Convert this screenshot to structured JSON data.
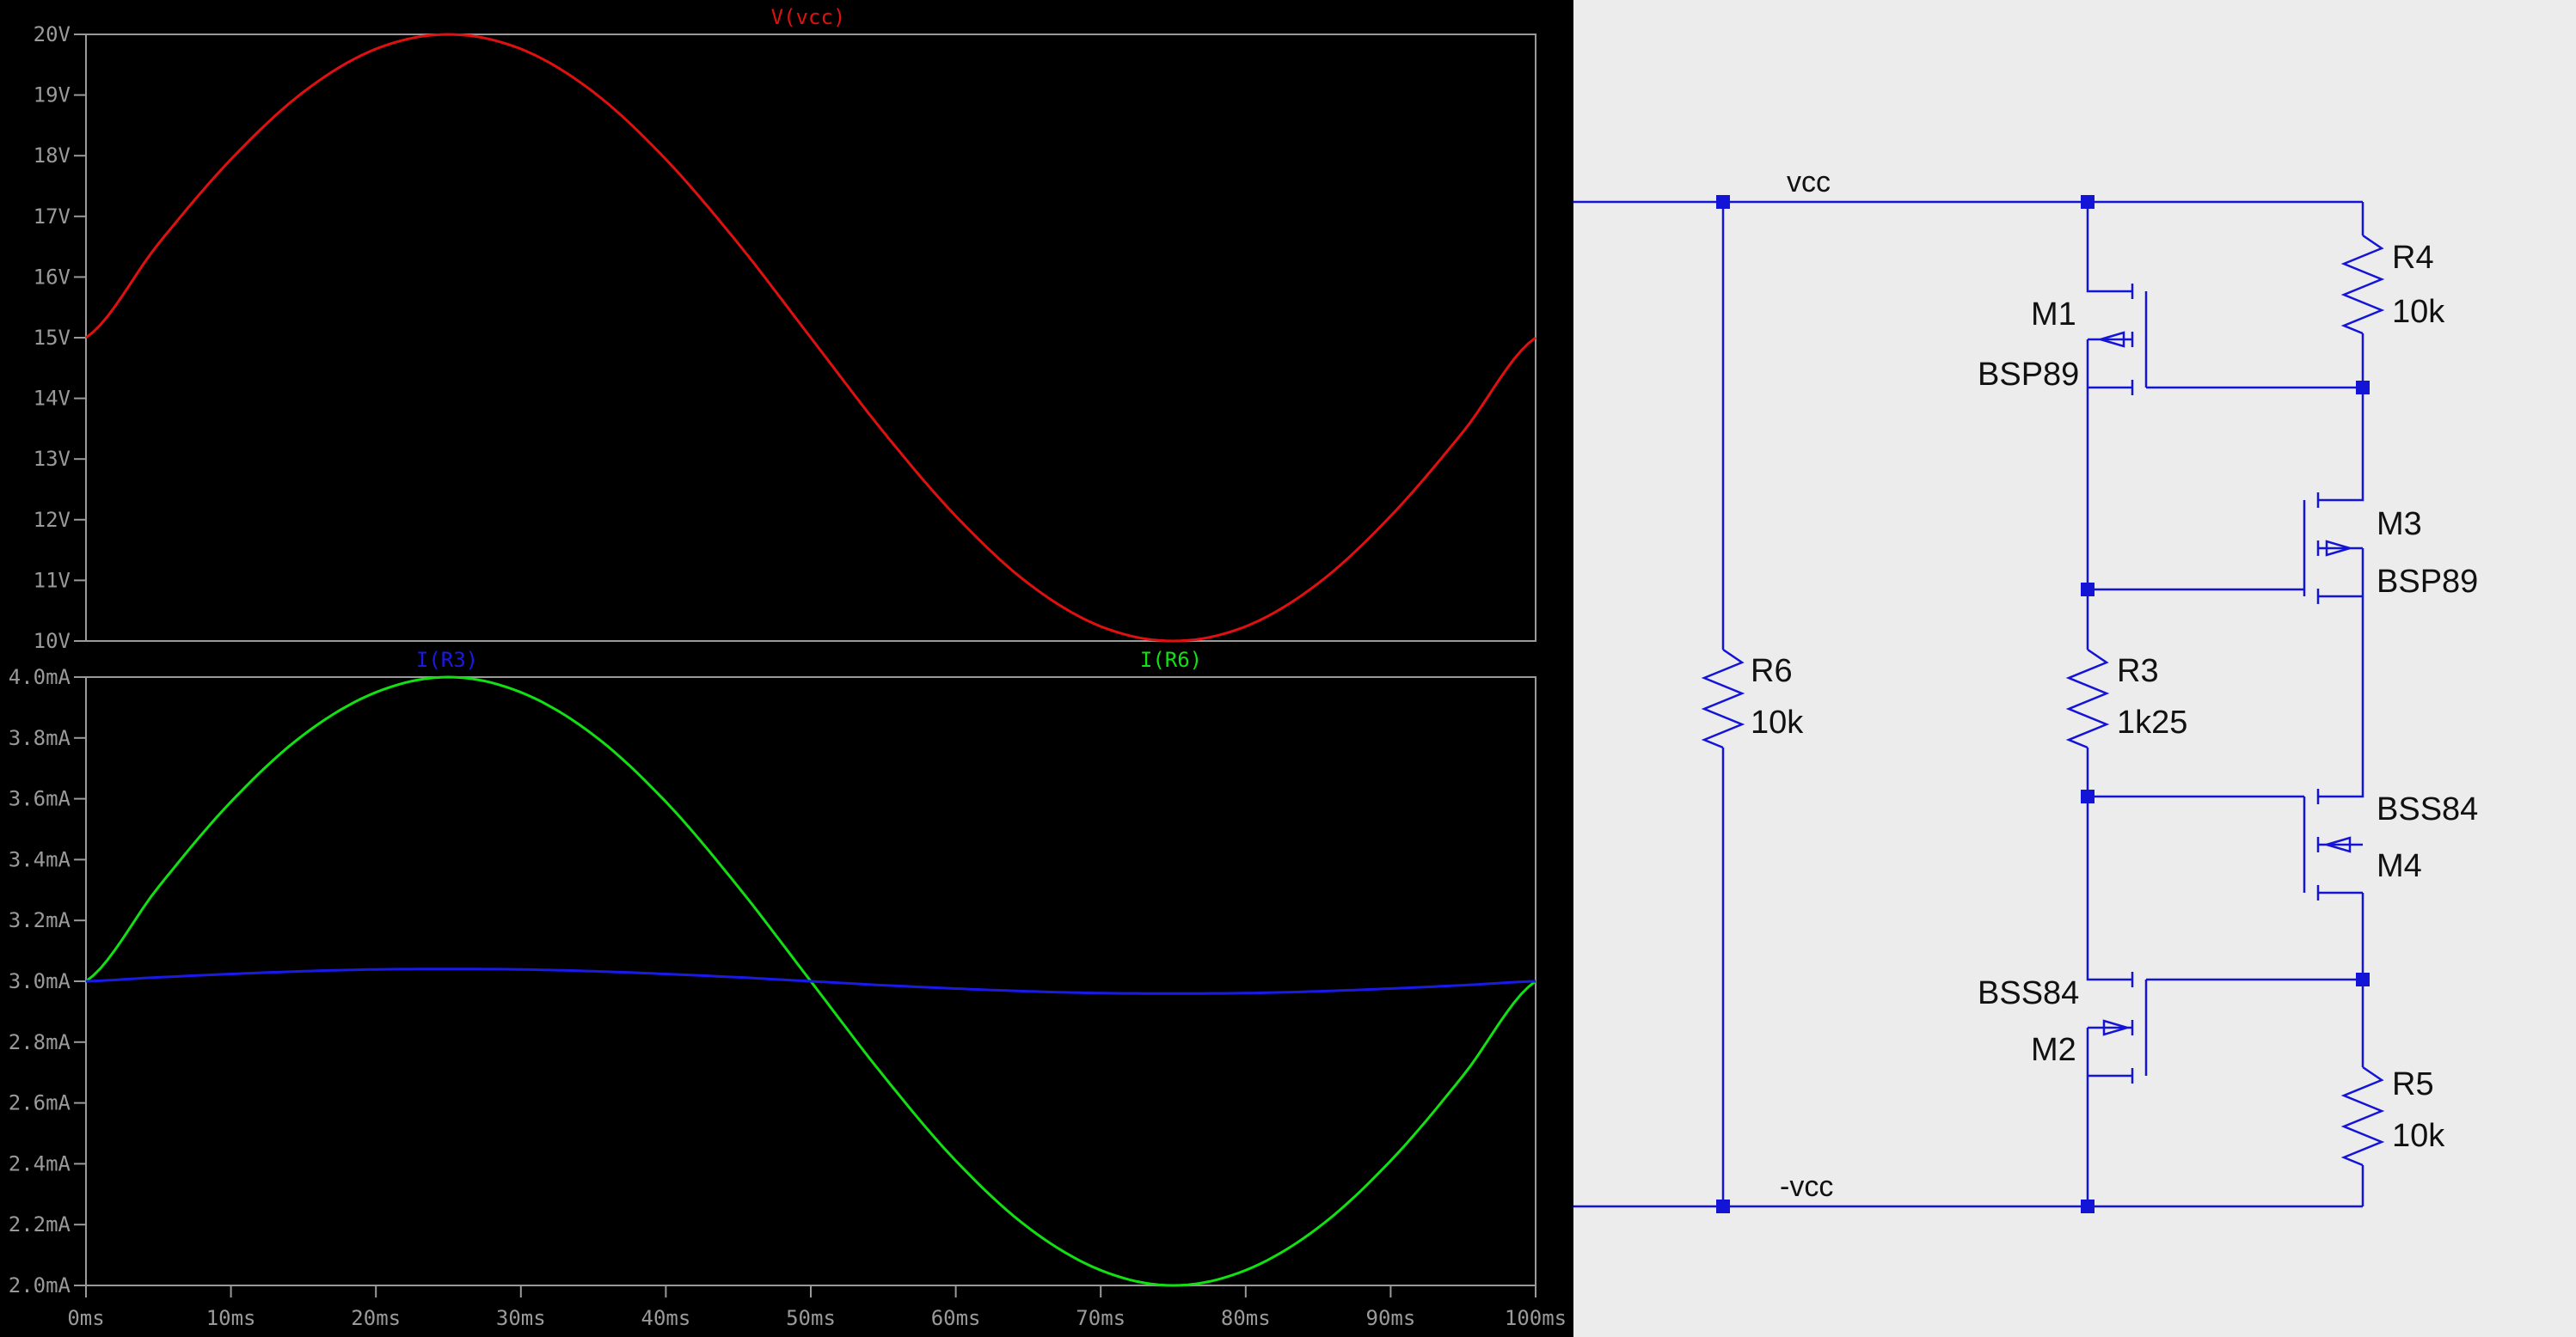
{
  "waveform": {
    "top_plot": {
      "traces": [
        {
          "label": "V(vcc)",
          "color": "#e01010"
        }
      ],
      "y_ticks": [
        "20V",
        "19V",
        "18V",
        "17V",
        "16V",
        "15V",
        "14V",
        "13V",
        "12V",
        "11V",
        "10V"
      ]
    },
    "bottom_plot": {
      "traces": [
        {
          "label": "I(R3)",
          "color": "#1a1ae6"
        },
        {
          "label": "I(R6)",
          "color": "#12e012"
        }
      ],
      "y_ticks": [
        "4.0mA",
        "3.8mA",
        "3.6mA",
        "3.4mA",
        "3.2mA",
        "3.0mA",
        "2.8mA",
        "2.6mA",
        "2.4mA",
        "2.2mA",
        "2.0mA"
      ]
    },
    "x_ticks": [
      "0ms",
      "10ms",
      "20ms",
      "30ms",
      "40ms",
      "50ms",
      "60ms",
      "70ms",
      "80ms",
      "90ms",
      "100ms"
    ]
  },
  "chart_data": [
    {
      "type": "line",
      "title": "",
      "xlabel": "",
      "ylabel": "",
      "x": [
        0,
        5,
        10,
        15,
        20,
        25,
        30,
        35,
        40,
        45,
        50,
        55,
        60,
        65,
        70,
        75,
        80,
        85,
        90,
        95,
        100
      ],
      "xlim": [
        0,
        100
      ],
      "ylim": [
        10,
        20
      ],
      "x_unit": "ms",
      "y_unit": "V",
      "grid": false,
      "series": [
        {
          "name": "V(vcc)",
          "color": "#e01010",
          "values": [
            15,
            16.55,
            17.94,
            19.05,
            19.76,
            20,
            19.76,
            19.05,
            17.94,
            16.55,
            15,
            13.45,
            12.06,
            10.95,
            10.24,
            10,
            10.24,
            10.95,
            12.06,
            13.45,
            15
          ]
        }
      ]
    },
    {
      "type": "line",
      "title": "",
      "xlabel": "",
      "ylabel": "",
      "x": [
        0,
        5,
        10,
        15,
        20,
        25,
        30,
        35,
        40,
        45,
        50,
        55,
        60,
        65,
        70,
        75,
        80,
        85,
        90,
        95,
        100
      ],
      "xlim": [
        0,
        100
      ],
      "ylim": [
        2.0,
        4.0
      ],
      "x_unit": "ms",
      "y_unit": "mA",
      "grid": false,
      "series": [
        {
          "name": "I(R6)",
          "color": "#12e012",
          "values": [
            3.0,
            3.31,
            3.59,
            3.81,
            3.95,
            4.0,
            3.95,
            3.81,
            3.59,
            3.31,
            3.0,
            2.69,
            2.41,
            2.19,
            2.05,
            2.0,
            2.05,
            2.19,
            2.41,
            2.69,
            3.0
          ]
        },
        {
          "name": "I(R3)",
          "color": "#1a1ae6",
          "values": [
            3.0,
            3.013,
            3.024,
            3.033,
            3.039,
            3.04,
            3.039,
            3.033,
            3.024,
            3.013,
            3.0,
            2.987,
            2.976,
            2.967,
            2.961,
            2.96,
            2.961,
            2.967,
            2.976,
            2.987,
            3.0
          ]
        }
      ]
    }
  ],
  "schematic": {
    "nets": {
      "vcc": "vcc",
      "neg_vcc": "-vcc"
    },
    "components": {
      "R4": {
        "ref": "R4",
        "value": "10k"
      },
      "R6": {
        "ref": "R6",
        "value": "10k"
      },
      "R3": {
        "ref": "R3",
        "value": "1k25"
      },
      "R5": {
        "ref": "R5",
        "value": "10k"
      },
      "M1": {
        "ref": "M1",
        "model": "BSP89"
      },
      "M3": {
        "ref": "M3",
        "model": "BSP89"
      },
      "M4": {
        "ref": "M4",
        "model": "BSS84"
      },
      "M2": {
        "ref": "M2",
        "model": "BSS84"
      }
    },
    "colors": {
      "wire": "#1414d6",
      "background": "#ececec",
      "label": "#111111"
    }
  }
}
